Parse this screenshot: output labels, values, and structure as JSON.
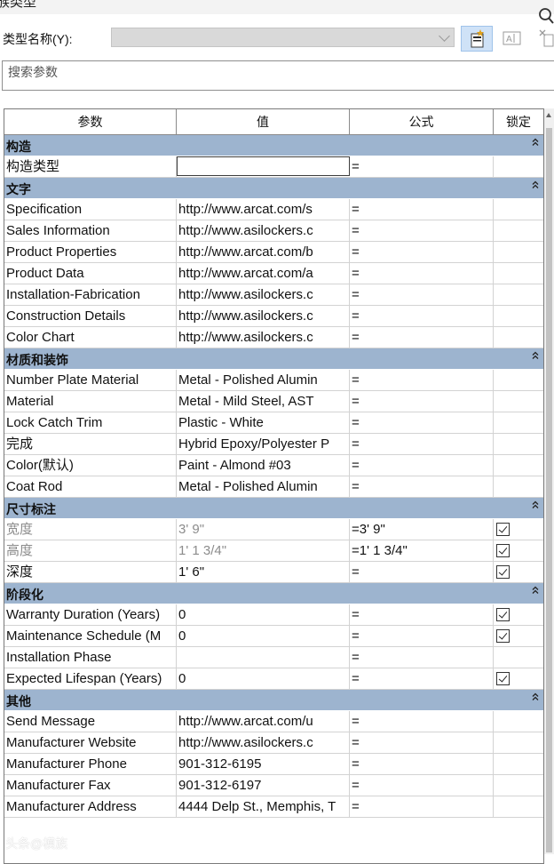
{
  "window": {
    "title": "族类型"
  },
  "type_selector": {
    "label": "类型名称(Y):",
    "value": ""
  },
  "search": {
    "placeholder": "搜索参数"
  },
  "columns": {
    "parameter": "参数",
    "value": "值",
    "formula": "公式",
    "lock": "锁定"
  },
  "groups": [
    {
      "title": "构造",
      "rows": [
        {
          "name": "构造类型",
          "value": "",
          "formula": "=",
          "lock": null,
          "editing": true
        }
      ]
    },
    {
      "title": "文字",
      "rows": [
        {
          "name": "Specification",
          "value": "http://www.arcat.com/s",
          "formula": "=",
          "lock": null
        },
        {
          "name": "Sales Information",
          "value": "http://www.asilockers.c",
          "formula": "=",
          "lock": null
        },
        {
          "name": "Product Properties",
          "value": "http://www.arcat.com/b",
          "formula": "=",
          "lock": null
        },
        {
          "name": "Product Data",
          "value": "http://www.arcat.com/a",
          "formula": "=",
          "lock": null
        },
        {
          "name": "Installation-Fabrication",
          "value": "http://www.asilockers.c",
          "formula": "=",
          "lock": null
        },
        {
          "name": "Construction Details",
          "value": "http://www.asilockers.c",
          "formula": "=",
          "lock": null
        },
        {
          "name": "Color Chart",
          "value": "http://www.asilockers.c",
          "formula": "=",
          "lock": null
        }
      ]
    },
    {
      "title": "材质和装饰",
      "rows": [
        {
          "name": "Number Plate Material",
          "value": "Metal - Polished Alumin",
          "formula": "=",
          "lock": null
        },
        {
          "name": "Material",
          "value": "Metal - Mild Steel, AST",
          "formula": "=",
          "lock": null
        },
        {
          "name": "Lock Catch Trim",
          "value": "Plastic - White",
          "formula": "=",
          "lock": null
        },
        {
          "name": "完成",
          "value": "Hybrid Epoxy/Polyester P",
          "formula": "=",
          "lock": null
        },
        {
          "name": "Color(默认)",
          "value": "Paint - Almond #03",
          "formula": "=",
          "lock": null
        },
        {
          "name": "Coat Rod",
          "value": "Metal - Polished Alumin",
          "formula": "=",
          "lock": null
        }
      ]
    },
    {
      "title": "尺寸标注",
      "rows": [
        {
          "name": "宽度",
          "value": "3'  9\"",
          "formula": "=3'  9\"",
          "lock": true,
          "greyed": true
        },
        {
          "name": "高度",
          "value": "1'  1 3/4\"",
          "formula": "=1'  1 3/4\"",
          "lock": true,
          "greyed": true
        },
        {
          "name": "深度",
          "value": "1'  6\"",
          "formula": "=",
          "lock": true
        }
      ]
    },
    {
      "title": "阶段化",
      "rows": [
        {
          "name": "Warranty Duration (Years)",
          "value": "0",
          "formula": "=",
          "lock": true
        },
        {
          "name": "Maintenance Schedule (M",
          "value": "0",
          "formula": "=",
          "lock": true
        },
        {
          "name": "Installation Phase",
          "value": "",
          "formula": "=",
          "lock": null
        },
        {
          "name": "Expected Lifespan (Years)",
          "value": "0",
          "formula": "=",
          "lock": true
        }
      ]
    },
    {
      "title": "其他",
      "rows": [
        {
          "name": "Send Message",
          "value": "http://www.arcat.com/u",
          "formula": "=",
          "lock": null
        },
        {
          "name": "Manufacturer Website",
          "value": "http://www.asilockers.c",
          "formula": "=",
          "lock": null
        },
        {
          "name": "Manufacturer Phone",
          "value": "901-312-6195",
          "formula": "=",
          "lock": null
        },
        {
          "name": "Manufacturer Fax",
          "value": "901-312-6197",
          "formula": "=",
          "lock": null
        },
        {
          "name": "Manufacturer Address",
          "value": "4444 Delp St., Memphis, T",
          "formula": "=",
          "lock": null
        }
      ]
    }
  ],
  "watermark": "头条@模族",
  "colors": {
    "group_header": "#9db4cf",
    "new_button": "#cfe2f7"
  },
  "icons": {
    "new_type": "new-type-icon",
    "rename": "rename-type-icon",
    "delete": "delete-type-icon",
    "search": "search-icon",
    "collapse": "collapse-icon",
    "checkbox": "checkbox-checked"
  }
}
